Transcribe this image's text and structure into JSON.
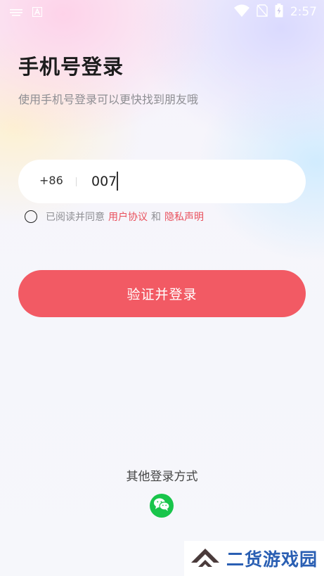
{
  "status_bar": {
    "time": "2:57",
    "icons": [
      "notification-icon",
      "a-icon",
      "wifi-icon",
      "no-sim-icon",
      "battery-charging-icon"
    ]
  },
  "header": {
    "title": "手机号登录",
    "subtitle": "使用手机号登录可以更快找到朋友哦"
  },
  "phone": {
    "country_code": "+86",
    "value": "007"
  },
  "agreement": {
    "prefix": "已阅读并同意",
    "user_agreement": "用户协议",
    "conjunction": "和",
    "privacy_policy": "隐私声明",
    "checked": false
  },
  "login_button": {
    "label": "验证并登录"
  },
  "other_login": {
    "title": "其他登录方式",
    "icons": [
      "wechat-icon"
    ]
  },
  "watermark": {
    "text": "二货游戏园"
  },
  "colors": {
    "accent": "#f25a64",
    "link": "#e9505c",
    "wechat": "#19c54b",
    "watermark": "#2a5fb3"
  }
}
